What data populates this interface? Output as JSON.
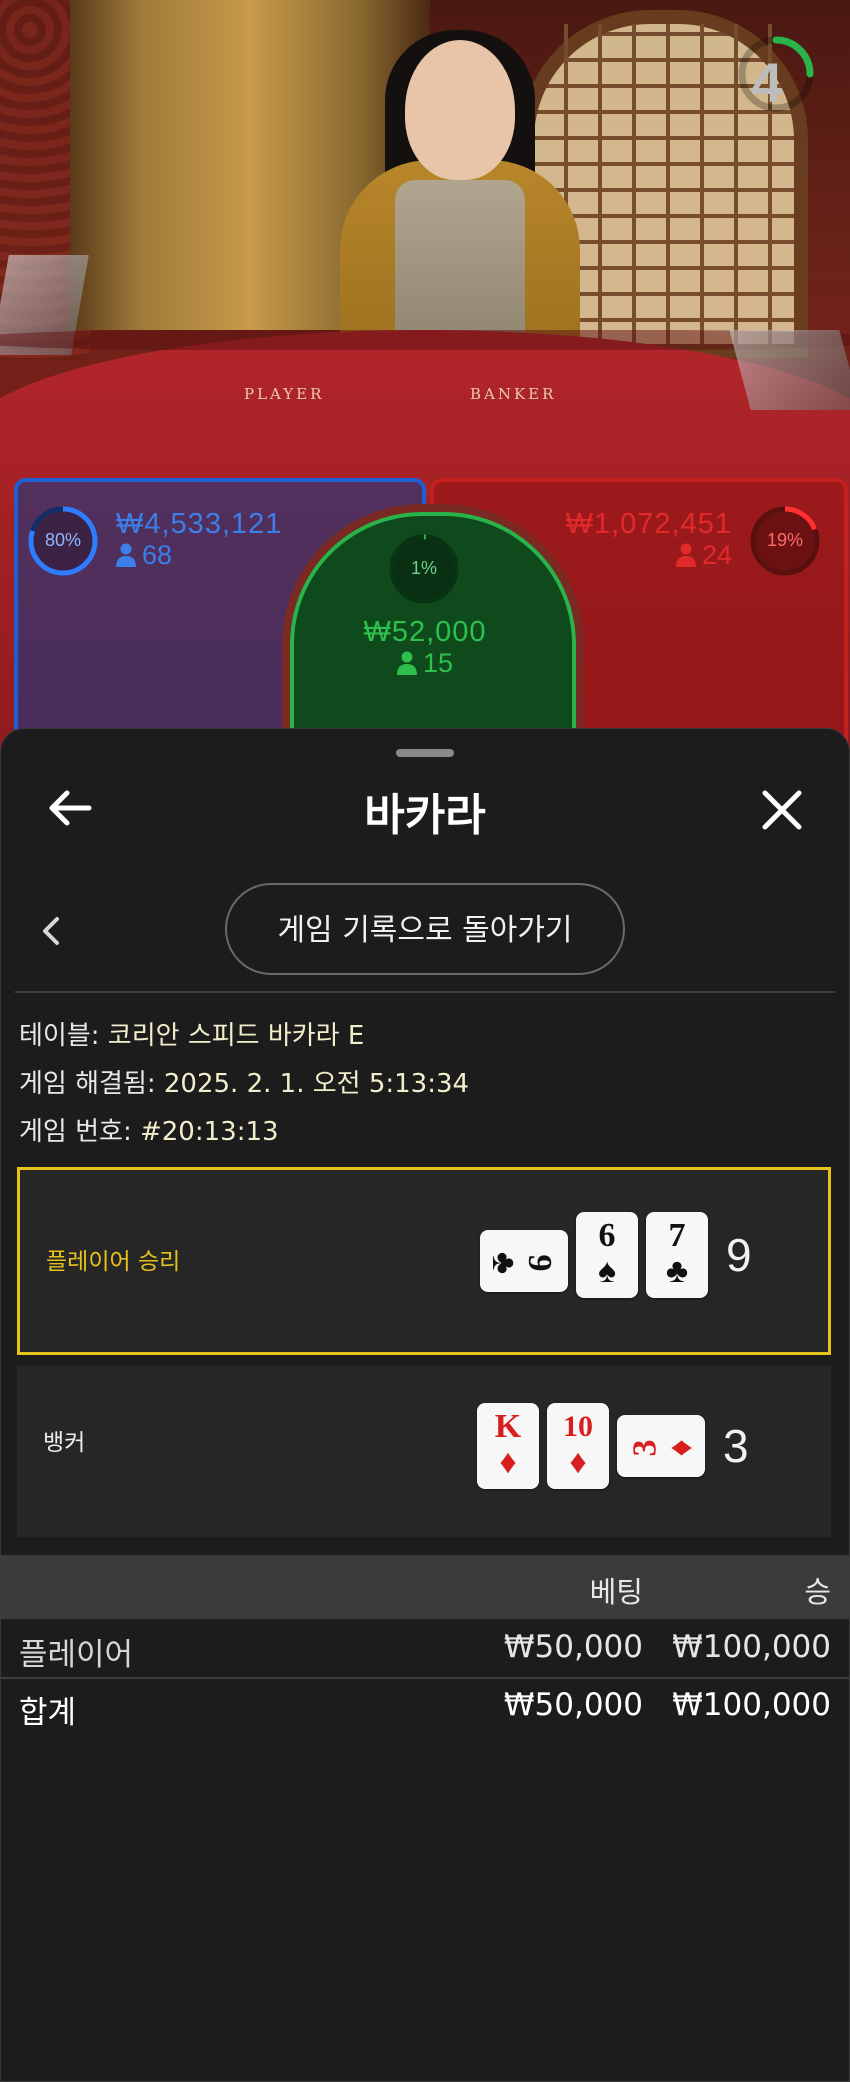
{
  "stream": {
    "timer": "4",
    "felt_labels": [
      "PLAYER",
      "BANKER"
    ],
    "player": {
      "percent": "80%",
      "amount": "₩4,533,121",
      "count": "68"
    },
    "tie": {
      "percent": "1%",
      "amount": "₩52,000",
      "count": "15"
    },
    "banker": {
      "percent": "19%",
      "amount": "₩1,072,451",
      "count": "24"
    }
  },
  "header": {
    "title": "바카라"
  },
  "history_button": "게임 기록으로 돌아가기",
  "info": {
    "table_label": "테이블:",
    "table_value": "코리안 스피드 바카라 E",
    "resolved_label": "게임 해결됨:",
    "resolved_value": "2025. 2. 1. 오전 5:13:34",
    "number_label": "게임 번호:",
    "number_value": "#20:13:13"
  },
  "results": {
    "player": {
      "label": "플레이어 승리",
      "score": "9",
      "cards": [
        {
          "rank": "9",
          "suit": "♣"
        },
        {
          "rank": "6",
          "suit": "♠"
        },
        {
          "rank": "7",
          "suit": "♣"
        }
      ]
    },
    "banker": {
      "label": "뱅커",
      "score": "3",
      "cards": [
        {
          "rank": "K",
          "suit": "♦"
        },
        {
          "rank": "10",
          "suit": "♦"
        },
        {
          "rank": "3",
          "suit": "♦"
        }
      ]
    }
  },
  "bets_table": {
    "headers": [
      "베팅",
      "승"
    ],
    "rows": [
      {
        "name": "플레이어",
        "bet": "₩50,000",
        "win": "₩100,000"
      }
    ],
    "total": {
      "name": "합계",
      "bet": "₩50,000",
      "win": "₩100,000"
    }
  },
  "colors": {
    "accent_gold": "#e6c31b",
    "player_blue": "#1e5fd6",
    "banker_red": "#c42020",
    "tie_green": "#2bb34b"
  }
}
